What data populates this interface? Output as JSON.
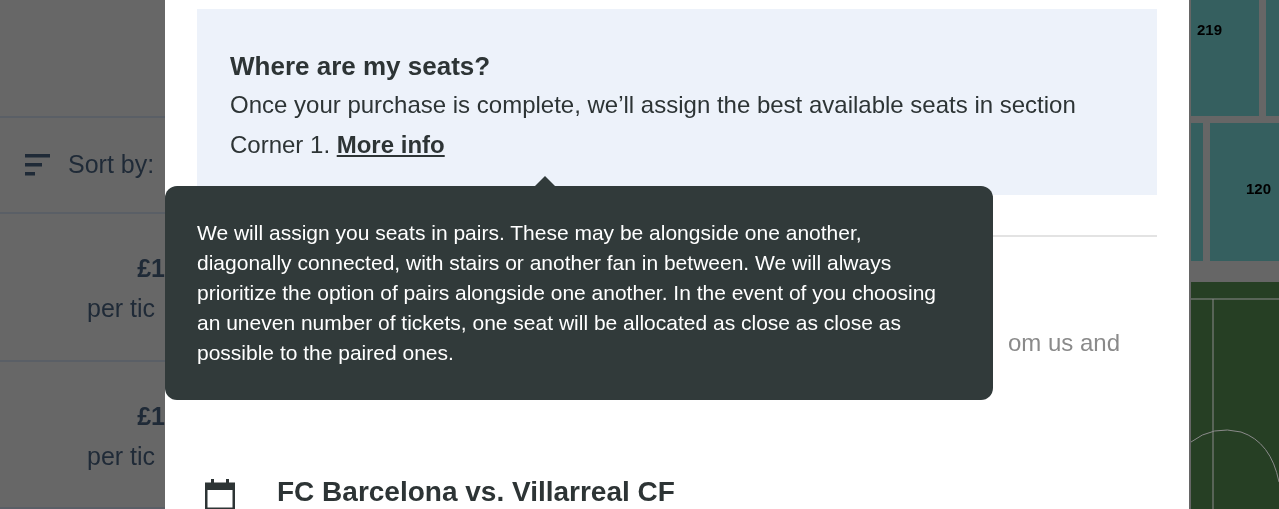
{
  "listing": {
    "sort_label": "Sort by:",
    "offers": [
      {
        "price": "£1",
        "unit": "per tic"
      },
      {
        "price": "£1",
        "unit": "per tic"
      }
    ]
  },
  "modal": {
    "info_box": {
      "title": "Where are my seats?",
      "text": "Once your purchase is complete, we’ll assign the best available seats in section Corner 1.",
      "link": "More info"
    },
    "hidden_line_end": "om us and",
    "event_title": "FC Barcelona vs. Villarreal CF"
  },
  "tooltip": {
    "text": "We will assign you seats in pairs. These may be alongside one another, diagonally connected, with stairs or another fan in between. We will always prioritize the option of pairs alongside one another. In the event of you choosing an uneven number of tickets, one seat will be allocated as close as close as possible to the paired ones."
  },
  "map": {
    "sections": [
      {
        "label": "219"
      },
      {
        "label": "120"
      }
    ]
  }
}
